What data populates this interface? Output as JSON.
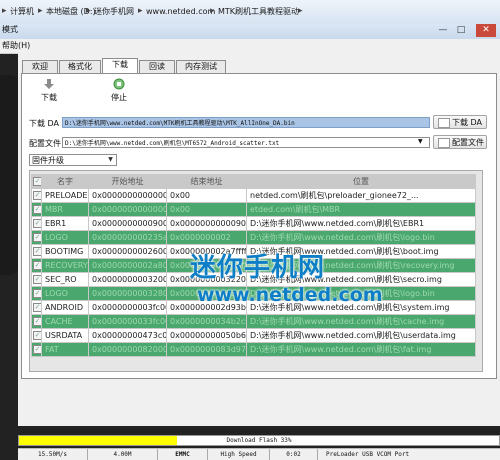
{
  "address_bar": {
    "crumbs": [
      "计算机",
      "本地磁盘 (D:)",
      "迷你手机网",
      "www.netded.com",
      "MTK刷机工具教程驱动"
    ]
  },
  "window": {
    "title": "模式",
    "minimize": "—",
    "maximize": "□",
    "close": "✕"
  },
  "menu": {
    "help": "帮助(H)"
  },
  "tabs": [
    "欢迎",
    "格式化",
    "下载",
    "回读",
    "内存测试"
  ],
  "toolbar": {
    "download": "下载",
    "stop": "停止"
  },
  "download_agent": {
    "label": "下载 DA",
    "value": "D:\\迷你手机网\\www.netded.com\\MTK刷机工具教程驱动\\MTK_AllInOne_DA.bin",
    "button": "下载 DA"
  },
  "scatter": {
    "label": "配置文件",
    "value": "D:\\迷你手机网\\www.netded.com\\刷机包\\MT6572_Android_scatter.txt",
    "button": "配置文件"
  },
  "mode_select": {
    "value": "固件升级"
  },
  "table": {
    "headers": [
      "名字",
      "开始地址",
      "结束地址",
      "位置"
    ],
    "rows": [
      {
        "name": "PRELOADER",
        "begin": "0x0000000000000000",
        "end": "0x00",
        "loc": "netded.com\\刷机包\\preloader_gionee72_...",
        "style": "white",
        "checked": true
      },
      {
        "name": "MBR",
        "begin": "0x0000000000000000",
        "end": "0x00",
        "loc": "etded.com\\刷机包\\MBR",
        "style": "green",
        "checked": true
      },
      {
        "name": "EBR1",
        "begin": "0x0000000000900000",
        "end": "0x000000000009001ff",
        "loc": "D:\\迷你手机网\\www.netded.com\\刷机包\\EBR1",
        "style": "white",
        "checked": true
      },
      {
        "name": "LOGO",
        "begin": "0x000000000235a000",
        "end": "0x0000000002",
        "loc": "D:\\迷你手机网\\www.netded.com\\刷机包\\logo.bin",
        "style": "green",
        "checked": true
      },
      {
        "name": "BOOTIMG",
        "begin": "0x0000000002600000",
        "end": "0x000000002a7ffff",
        "loc": "D:\\迷你手机网\\www.netded.com\\刷机包\\boot.img",
        "style": "white",
        "checked": true
      },
      {
        "name": "RECOVERY",
        "begin": "0x0000000002a80000",
        "end": "0x00000000030fffff",
        "loc": "D:\\迷你手机网\\www.netded.com\\刷机包\\recovery.img",
        "style": "green",
        "checked": true
      },
      {
        "name": "SEC_RO",
        "begin": "0x0000000003200000",
        "end": "0x0000000003220fff",
        "loc": "D:\\迷你手机网\\www.netded.com\\刷机包\\secro.img",
        "style": "white",
        "checked": true
      },
      {
        "name": "LOGO",
        "begin": "0x0000000003280000",
        "end": "0x000000000337ffff",
        "loc": "D:\\迷你手机网\\www.netded.com\\刷机包\\logo.bin",
        "style": "green",
        "checked": true
      },
      {
        "name": "ANDROID",
        "begin": "0x0000000003fc0000",
        "end": "0x000000002d93bbb7",
        "loc": "D:\\迷你手机网\\www.netded.com\\刷机包\\system.img",
        "style": "white",
        "checked": true
      },
      {
        "name": "CACHE",
        "begin": "0x0000000033fc0000",
        "end": "0x0000000034b2c0d7",
        "loc": "D:\\迷你手机网\\www.netded.com\\刷机包\\cache.img",
        "style": "green",
        "checked": true
      },
      {
        "name": "USRDATA",
        "begin": "0x00000000473c0000",
        "end": "0x00000000050b6f24f",
        "loc": "D:\\迷你手机网\\www.netded.com\\刷机包\\userdata.img",
        "style": "white",
        "checked": true
      },
      {
        "name": "FAT",
        "begin": "0x0000000082000000",
        "end": "0x0000000083d97fff",
        "loc": "D:\\迷你手机网\\www.netded.com\\刷机包\\fat.img",
        "style": "green",
        "checked": true
      }
    ]
  },
  "watermark": {
    "line1": "迷你手机网",
    "line2": "www.netded.com"
  },
  "progress": {
    "text": "Download Flash 33%",
    "percent": 33,
    "color": "#ffff00"
  },
  "status": [
    "15.50M/s",
    "4.00M",
    "EMMC",
    "High Speed",
    "0:02",
    "PreLoader USB VCOM Port"
  ]
}
